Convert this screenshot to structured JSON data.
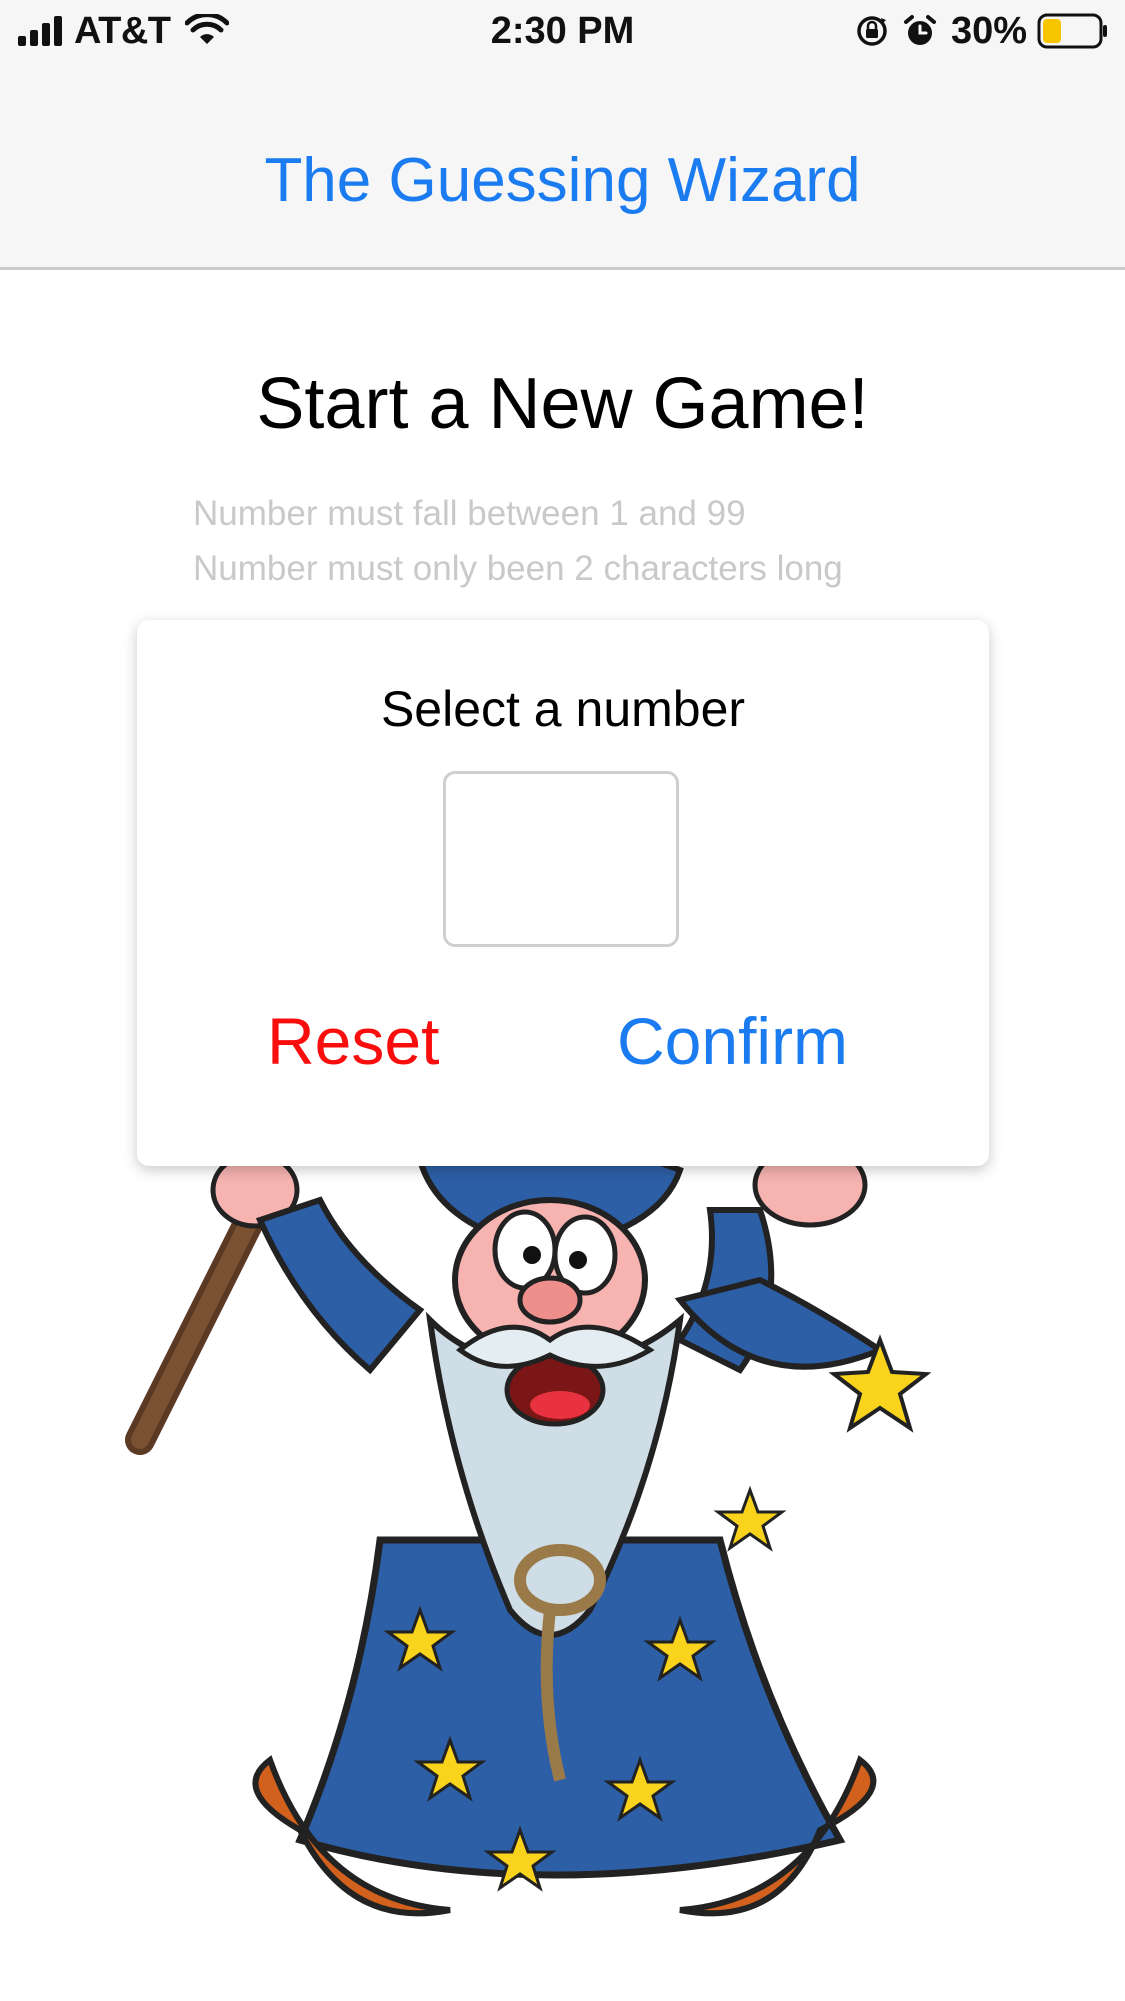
{
  "status_bar": {
    "carrier": "AT&T",
    "time": "2:30 PM",
    "battery_percent": "30%",
    "icons": [
      "signal-bars-icon",
      "wifi-icon",
      "orientation-lock-icon",
      "alarm-icon",
      "battery-icon"
    ]
  },
  "nav": {
    "title": "The Guessing Wizard"
  },
  "main": {
    "heading": "Start a New Game!",
    "hints": [
      "Number must fall between 1 and 99",
      "Number must only been 2 characters long"
    ]
  },
  "card": {
    "title": "Select a number",
    "input_value": "",
    "reset_label": "Reset",
    "confirm_label": "Confirm"
  },
  "image": {
    "name": "wizard-illustration"
  },
  "colors": {
    "accent_blue": "#1a7cf0",
    "reset_red": "#fa0d0d",
    "hint_gray": "#c9c9c9",
    "battery_yellow": "#f6c500"
  }
}
